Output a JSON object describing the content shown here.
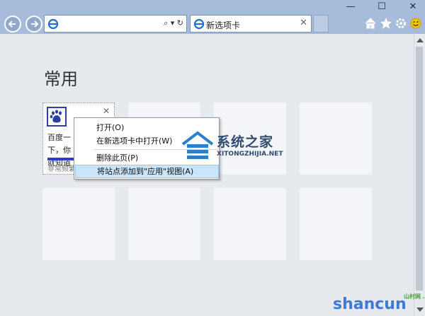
{
  "window": {
    "minimize_glyph": "—",
    "maximize_glyph": "☐",
    "close_glyph": "✕"
  },
  "toolbar": {
    "address_tools": "⌕ ▾ ↻",
    "tab_title": "新选项卡",
    "tab_close": "✕",
    "icons": [
      "back-icon",
      "forward-icon",
      "home-icon",
      "favorites-icon",
      "settings-icon",
      "smiley-icon"
    ]
  },
  "content": {
    "section_title": "常用",
    "tiles": [
      {
        "title": "百度一下，你就知道",
        "freq_label": "非常频繁",
        "close": "✕",
        "icon": "baidu-paw-icon"
      }
    ]
  },
  "context_menu": {
    "items": [
      {
        "label": "打开(O)"
      },
      {
        "label": "在新选项卡中打开(W)"
      },
      {
        "label": "删除此页(P)"
      },
      {
        "label": "将站点添加到\"应用\"视图(A)"
      }
    ],
    "highlighted_index": 3
  },
  "watermarks": {
    "site_title": "系统之家",
    "site_url": "XITONGZHIJIA.NET",
    "corner_brand": "shancun",
    "corner_sub": "山村网 .net"
  },
  "colors": {
    "chrome": "#a6bcda",
    "content_bg": "#e6e9ee",
    "menu_highlight": "#cce4f7",
    "freq_bar": "#2b3ec8"
  }
}
